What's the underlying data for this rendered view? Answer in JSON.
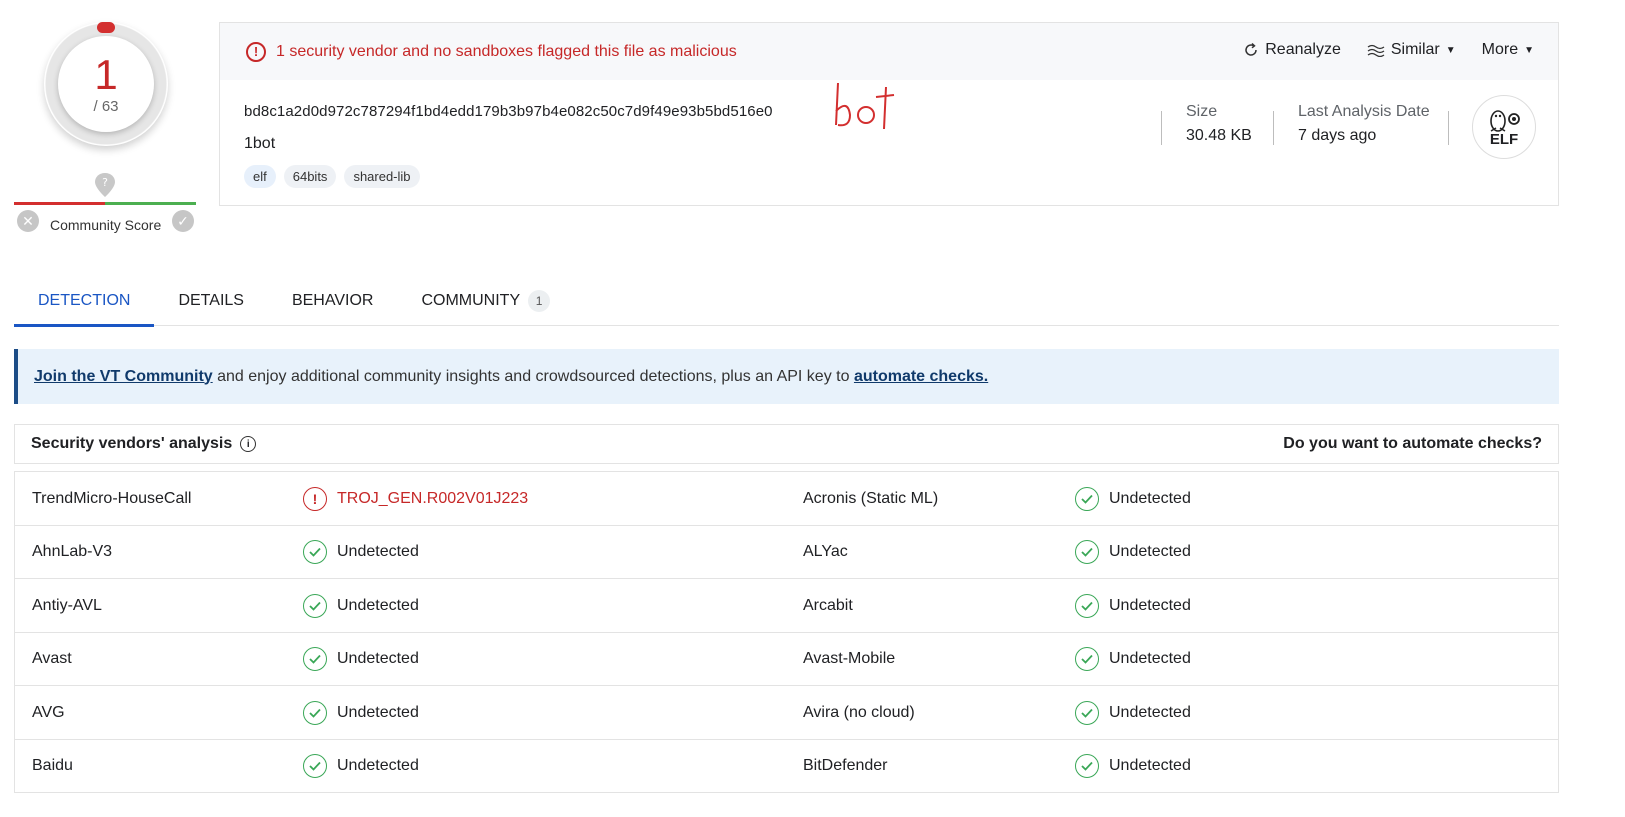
{
  "score": {
    "detections": "1",
    "total": "/ 63"
  },
  "community": {
    "label": "Community Score"
  },
  "alert": {
    "text": "1 security vendor and no sandboxes flagged this file as malicious"
  },
  "actions": {
    "reanalyze": "Reanalyze",
    "similar": "Similar",
    "more": "More"
  },
  "file": {
    "hash": "bd8c1a2d0d972c787294f1bd4edd179b3b97b4e082c50c7d9f49e93b5bd516e0",
    "name": "1bot",
    "tags": [
      "elf",
      "64bits",
      "shared-lib"
    ],
    "annotation": "bot",
    "size_label": "Size",
    "size_value": "30.48 KB",
    "date_label": "Last Analysis Date",
    "date_value": "7 days ago",
    "type_badge": "ELF"
  },
  "tabs": [
    {
      "label": "DETECTION"
    },
    {
      "label": "DETAILS"
    },
    {
      "label": "BEHAVIOR"
    },
    {
      "label": "COMMUNITY",
      "badge": "1"
    }
  ],
  "banner": {
    "link1": "Join the VT Community",
    "middle": " and enjoy additional community insights and crowdsourced detections, plus an API key to ",
    "link2": "automate checks."
  },
  "vendors": {
    "title": "Security vendors' analysis",
    "automate": "Do you want to automate checks?",
    "rows": [
      {
        "v1": "TrendMicro-HouseCall",
        "r1": "TROJ_GEN.R002V01J223",
        "v2": "Acronis (Static ML)",
        "r2": "Undetected"
      },
      {
        "v1": "AhnLab-V3",
        "r1": "Undetected",
        "v2": "ALYac",
        "r2": "Undetected"
      },
      {
        "v1": "Antiy-AVL",
        "r1": "Undetected",
        "v2": "Arcabit",
        "r2": "Undetected"
      },
      {
        "v1": "Avast",
        "r1": "Undetected",
        "v2": "Avast-Mobile",
        "r2": "Undetected"
      },
      {
        "v1": "AVG",
        "r1": "Undetected",
        "v2": "Avira (no cloud)",
        "r2": "Undetected"
      },
      {
        "v1": "Baidu",
        "r1": "Undetected",
        "v2": "BitDefender",
        "r2": "Undetected"
      }
    ]
  },
  "colors": {
    "malicious": "#c62828",
    "clean": "#3aa757",
    "accent": "#1a56c4"
  }
}
